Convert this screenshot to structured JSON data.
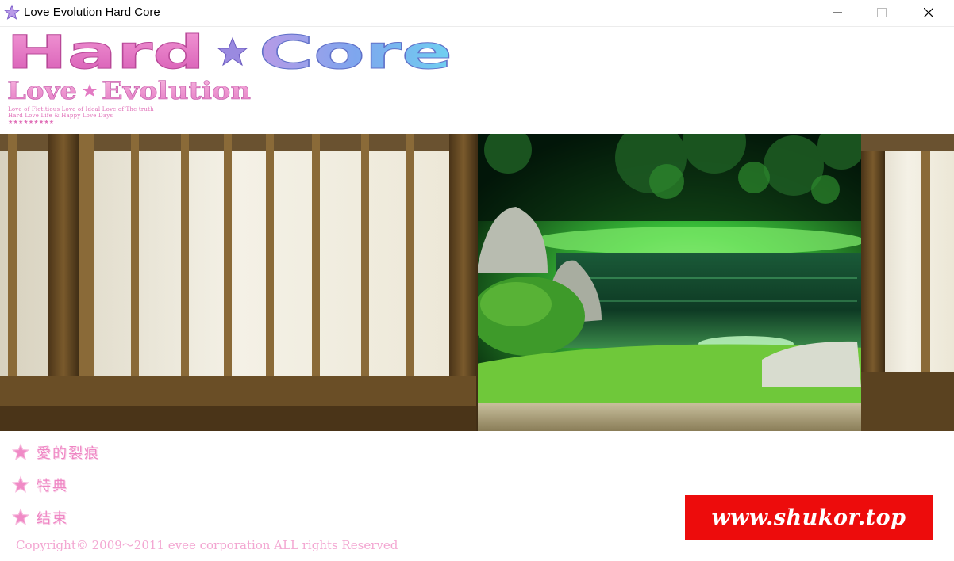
{
  "window": {
    "title": "Love Evolution Hard Core",
    "icon": "purple-star-icon",
    "controls": [
      "minimize-icon",
      "maximize-icon",
      "close-icon"
    ]
  },
  "logo": {
    "word1": "Hard",
    "word2": "Core",
    "subtitle_word1": "Love",
    "subtitle_word2": "Evolution",
    "tagline_line1": "Love of Fictitious   Love of Ideal   Love of The truth",
    "tagline_line2": "Hard Love Life & Happy Love Days",
    "tagline_stars": "★★★★★★★★★"
  },
  "menu": {
    "items": [
      {
        "label": "愛的裂痕",
        "icon": "pink-star-icon"
      },
      {
        "label": "特典",
        "icon": "pink-star-icon"
      },
      {
        "label": "结束",
        "icon": "pink-star-icon"
      }
    ]
  },
  "footer": {
    "copyright": "Copyright© 2009～2011  evee  corporation  ALL  rights  Reserved"
  },
  "watermark": {
    "text": "www.shukor.top"
  },
  "colors": {
    "menu_pink": "#ef86c4",
    "logo_pink": "#ea82c8",
    "logo_blue": "#8fa8f0",
    "watermark_red": "#ed0c0c"
  }
}
